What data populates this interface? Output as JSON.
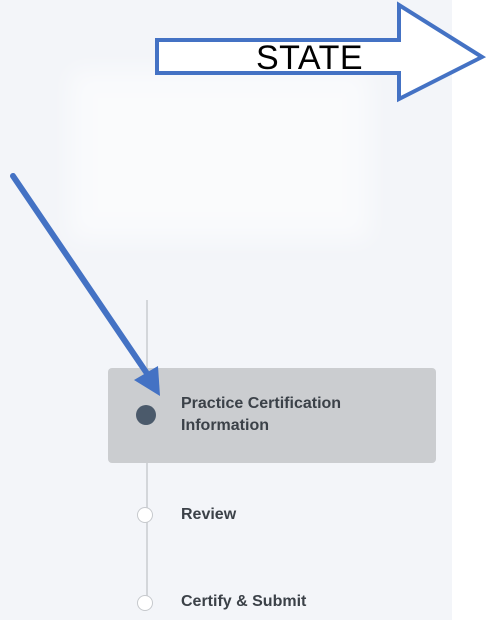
{
  "annotation": {
    "state_label": "STATE",
    "arrow_color": "#4472c4"
  },
  "stepper": {
    "steps": [
      {
        "label": "Practice Certification\nInformation",
        "status": "active"
      },
      {
        "label": "Review",
        "status": "pending"
      },
      {
        "label": "Certify & Submit",
        "status": "pending"
      }
    ]
  },
  "colors": {
    "panel_bg": "#f3f5f9",
    "active_step_bg": "#cbcdd0",
    "active_node": "#4b5a6b",
    "step_text": "#3b4148",
    "connector": "#d3d6da"
  }
}
